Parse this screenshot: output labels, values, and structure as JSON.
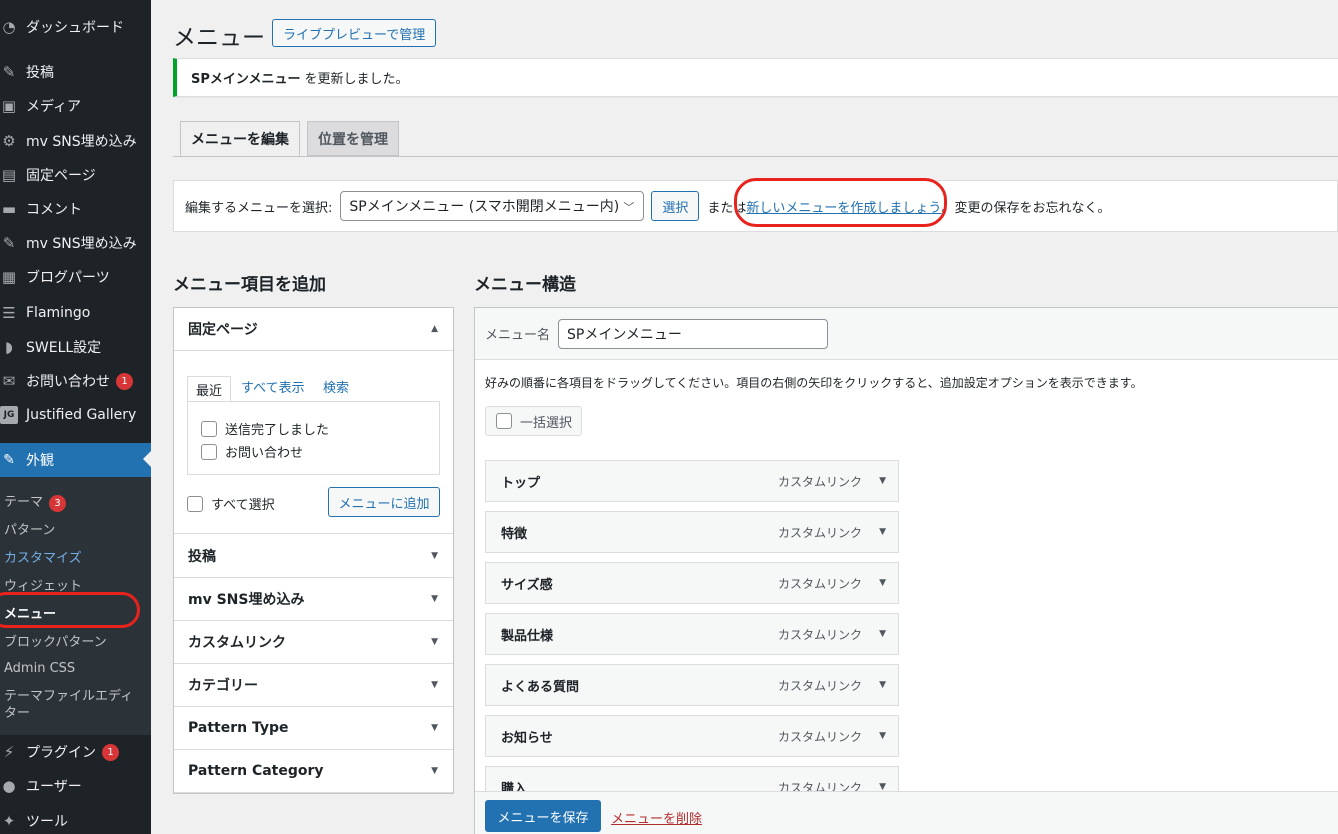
{
  "sidebar": {
    "items": [
      {
        "label": "ダッシュボード",
        "icon": "dashboard-icon"
      },
      {
        "label": "投稿",
        "icon": "pin-icon"
      },
      {
        "label": "メディア",
        "icon": "media-icon"
      },
      {
        "label": "mv SNS埋め込み",
        "icon": "gear-icon"
      },
      {
        "label": "固定ページ",
        "icon": "page-icon"
      },
      {
        "label": "コメント",
        "icon": "comment-icon"
      },
      {
        "label": "mv SNS埋め込み",
        "icon": "pin-icon"
      },
      {
        "label": "ブログパーツ",
        "icon": "grid-icon"
      },
      {
        "label": "Flamingo",
        "icon": "list-icon"
      },
      {
        "label": "SWELL設定",
        "icon": "swell-icon"
      },
      {
        "label": "お問い合わせ",
        "icon": "mail-icon",
        "badge": "1"
      },
      {
        "label": "Justified Gallery",
        "icon": "jg-icon"
      }
    ],
    "active": {
      "label": "外観",
      "icon": "brush-icon"
    },
    "submenu": [
      {
        "label": "テーマ",
        "badge": "3"
      },
      {
        "label": "パターン"
      },
      {
        "label": "カスタマイズ"
      },
      {
        "label": "ウィジェット"
      },
      {
        "label": "メニュー"
      },
      {
        "label": "ブロックパターン"
      },
      {
        "label": "Admin CSS"
      },
      {
        "label": "テーマファイルエディター"
      }
    ],
    "bottom_items": [
      {
        "label": "プラグイン",
        "icon": "plugin-icon",
        "badge": "1"
      },
      {
        "label": "ユーザー",
        "icon": "user-icon"
      },
      {
        "label": "ツール",
        "icon": "wrench-icon"
      }
    ]
  },
  "header": {
    "title": "メニュー",
    "live_preview_label": "ライブプレビューで管理"
  },
  "notice": {
    "menu_name": "SPメインメニュー",
    "text": "を更新しました。"
  },
  "tabs": {
    "edit": "メニューを編集",
    "locations": "位置を管理"
  },
  "manage_bar": {
    "select_label": "編集するメニューを選択:",
    "selected_menu": "SPメインメニュー (スマホ開閉メニュー内)",
    "select_button": "選択",
    "or_text": "または",
    "create_link": "新しいメニューを作成しましょう",
    "suffix": "。変更の保存をお忘れなく。"
  },
  "add_items": {
    "heading": "メニュー項目を追加",
    "pages": {
      "title": "固定ページ",
      "tab_recent": "最近",
      "tab_all": "すべて表示",
      "tab_search": "検索",
      "items": [
        "送信完了しました",
        "お問い合わせ"
      ],
      "select_all": "すべて選択",
      "add_button": "メニューに追加"
    },
    "sections": [
      "投稿",
      "mv SNS埋め込み",
      "カスタムリンク",
      "カテゴリー",
      "Pattern Type",
      "Pattern Category"
    ]
  },
  "structure": {
    "heading": "メニュー構造",
    "name_label": "メニュー名",
    "name_value": "SPメインメニュー",
    "instructions": "好みの順番に各項目をドラッグしてください。項目の右側の矢印をクリックすると、追加設定オプションを表示できます。",
    "bulk_select": "一括選択",
    "items": [
      {
        "title": "トップ",
        "type": "カスタムリンク"
      },
      {
        "title": "特徴",
        "type": "カスタムリンク"
      },
      {
        "title": "サイズ感",
        "type": "カスタムリンク"
      },
      {
        "title": "製品仕様",
        "type": "カスタムリンク"
      },
      {
        "title": "よくある質問",
        "type": "カスタムリンク"
      },
      {
        "title": "お知らせ",
        "type": "カスタムリンク"
      },
      {
        "title": "購入",
        "type": "カスタムリンク"
      }
    ],
    "save_button": "メニューを保存",
    "delete_link": "メニューを削除"
  },
  "colors": {
    "sidebar_bg": "#1d2327",
    "accent": "#2271b1",
    "notice_success": "#00a32a",
    "annotation_ring": "#e8221c",
    "delete": "#b32d2e"
  }
}
